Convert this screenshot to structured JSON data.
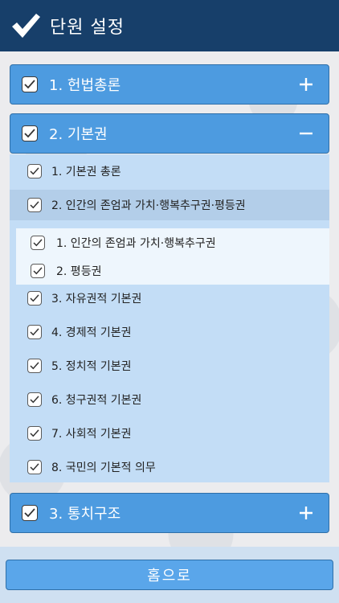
{
  "header": {
    "title": "단원 설정",
    "icon": "checkmark-icon"
  },
  "units": [
    {
      "label": "1. 헌법총론",
      "checked": true,
      "expanded": false,
      "toggle": "plus-icon"
    },
    {
      "label": "2. 기본권",
      "checked": true,
      "expanded": true,
      "toggle": "minus-icon",
      "chapters": [
        {
          "label": "1. 기본권 총론",
          "checked": true
        },
        {
          "label": "2. 인간의 존엄과 가치·행복추구권·평등권",
          "checked": true,
          "selected": true,
          "sections": [
            {
              "label": "1. 인간의 존엄과 가치·행복추구권",
              "checked": true
            },
            {
              "label": "2. 평등권",
              "checked": true
            }
          ]
        },
        {
          "label": "3. 자유권적 기본권",
          "checked": true
        },
        {
          "label": "4. 경제적 기본권",
          "checked": true
        },
        {
          "label": "5. 정치적 기본권",
          "checked": true
        },
        {
          "label": "6. 청구권적 기본권",
          "checked": true
        },
        {
          "label": "7. 사회적 기본권",
          "checked": true
        },
        {
          "label": "8. 국민의 기본적 의무",
          "checked": true
        }
      ]
    },
    {
      "label": "3. 통치구조",
      "checked": true,
      "expanded": false,
      "toggle": "plus-icon"
    }
  ],
  "footer": {
    "home_label": "홈으로"
  },
  "colors": {
    "header": "#173f6a",
    "unit": "#4d9be0",
    "panel": "#c3ddf6",
    "subpanel": "#eef6fd",
    "home": "#5aa6ea"
  }
}
